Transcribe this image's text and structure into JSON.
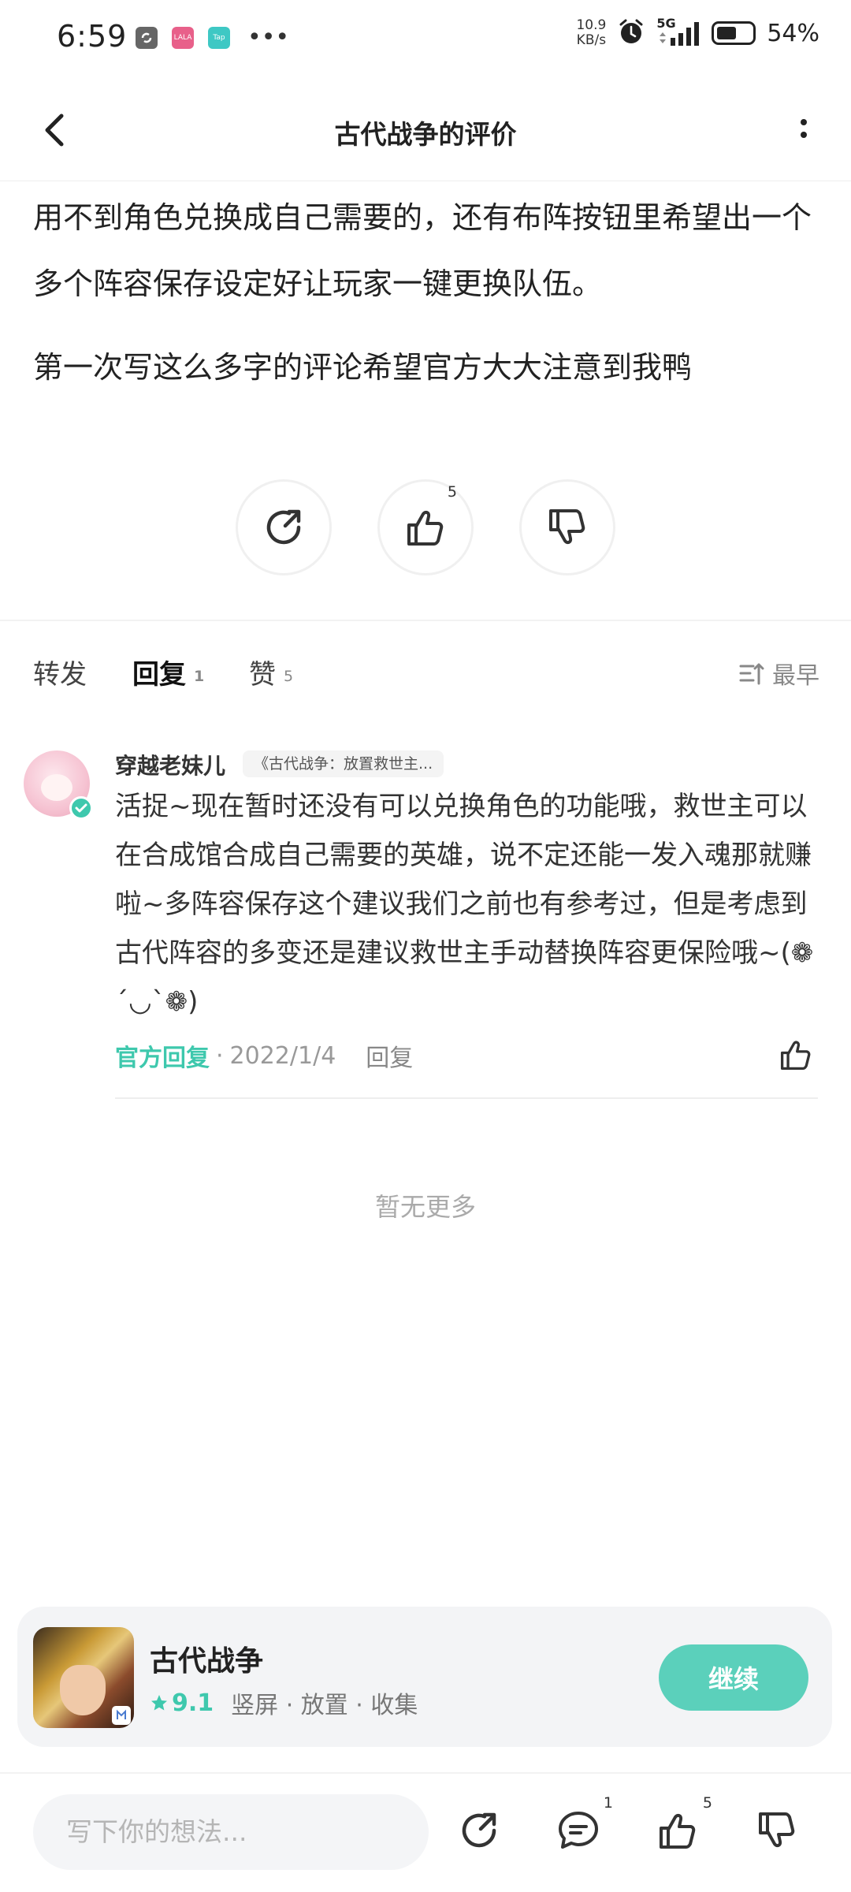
{
  "status_bar": {
    "time": "6:59",
    "speed_value": "10.9",
    "speed_unit": "KB/s",
    "network": "5G",
    "battery_percent": "54%",
    "battery_level": 0.54,
    "app_icons": [
      {
        "name": "app-icon-1",
        "label": "",
        "color": "#888888"
      },
      {
        "name": "app-icon-lala",
        "label": "LALA",
        "color": "#e8608a"
      },
      {
        "name": "app-icon-taptap",
        "label": "Tap",
        "color": "#3ec8c4"
      }
    ]
  },
  "header": {
    "title": "古代战争的评价"
  },
  "review": {
    "paragraph_1": "用不到角色兑换成自己需要的，还有布阵按钮里希望出一个多个阵容保存设定好让玩家一键更换队伍。",
    "paragraph_2": "第一次写这么多字的评论希望官方大大注意到我鸭",
    "actions": {
      "share_icon": "share-icon",
      "like_icon": "thumbs-up-icon",
      "like_count": "5",
      "dislike_icon": "thumbs-down-icon"
    }
  },
  "tabs": {
    "items": [
      {
        "label": "转发",
        "count": ""
      },
      {
        "label": "回复",
        "count": "1"
      },
      {
        "label": "赞",
        "count": "5"
      }
    ],
    "active_index": 1,
    "sort_label": "最早"
  },
  "reply": {
    "author": "穿越老妹儿",
    "game_tag": "《古代战争：放置救世主...",
    "text": "活捉~现在暂时还没有可以兑换角色的功能哦，救世主可以在合成馆合成自己需要的英雄，说不定还能一发入魂那就赚啦~多阵容保存这个建议我们之前也有参考过，但是考虑到古代阵容的多变还是建议救世主手动替换阵容更保险哦~(❁´◡`❁)",
    "official_label": "官方回复",
    "separator": "·",
    "date": "2022/1/4",
    "reply_label": "回复"
  },
  "no_more_text": "暂无更多",
  "game_card": {
    "name": "古代战争",
    "rating": "9.1",
    "tags": "竖屏 · 放置 · 收集",
    "continue_label": "继续"
  },
  "bottom_bar": {
    "input_placeholder": "写下你的想法...",
    "comment_count": "1",
    "like_count": "5"
  },
  "colors": {
    "accent": "#3ec8ad",
    "button": "#5bd0bb"
  }
}
